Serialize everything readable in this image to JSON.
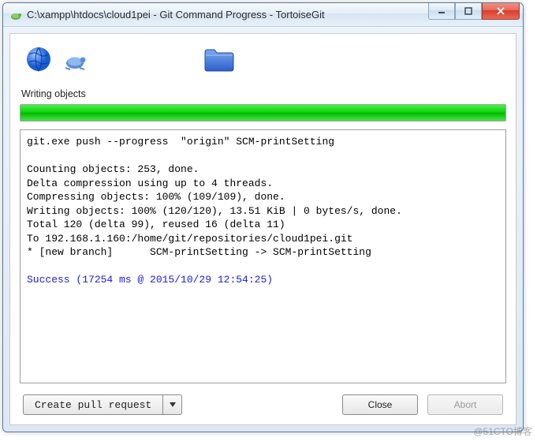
{
  "window": {
    "title": "C:\\xampp\\htdocs\\cloud1pei - Git Command Progress - TortoiseGit"
  },
  "status": {
    "label": "Writing objects"
  },
  "console": {
    "command": "git.exe push --progress  \"origin\" SCM-printSetting",
    "lines": [
      "Counting objects: 253, done.",
      "Delta compression using up to 4 threads.",
      "Compressing objects: 100% (109/109), done.",
      "Writing objects: 100% (120/120), 13.51 KiB | 0 bytes/s, done.",
      "Total 120 (delta 99), reused 16 (delta 11)",
      "To 192.168.1.160:/home/git/repositories/cloud1pei.git",
      "* [new branch]      SCM-printSetting -> SCM-printSetting"
    ],
    "success": "Success (17254 ms @ 2015/10/29 12:54:25)"
  },
  "buttons": {
    "pull_request": "Create pull request",
    "close": "Close",
    "abort": "Abort"
  },
  "watermark": "@51CTO博客"
}
